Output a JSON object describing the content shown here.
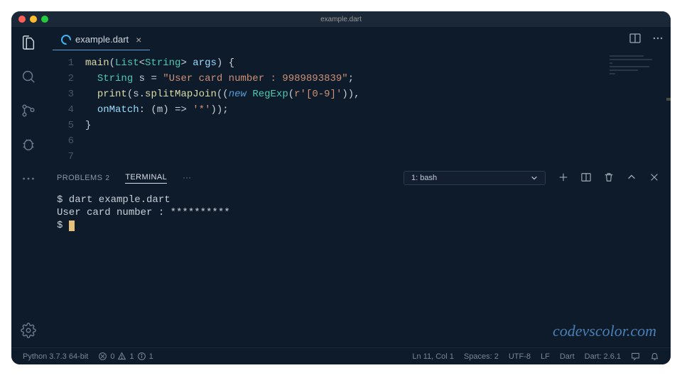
{
  "title": "example.dart",
  "tab": {
    "label": "example.dart"
  },
  "code": {
    "lines": [
      "1",
      "2",
      "3",
      "4",
      "5",
      "6",
      "7"
    ],
    "l1": {
      "fn": "main",
      "p1": "(",
      "type1": "List",
      "lt": "<",
      "type2": "String",
      "gt": ">",
      "sp": " ",
      "param": "args",
      "p2": ") {"
    },
    "l2": {
      "indent": "  ",
      "type": "String",
      "var": " s ",
      "eq": "=",
      "sp": " ",
      "str": "\"User card number : 9989893839\"",
      "sc": ";"
    },
    "l3": "",
    "l4": {
      "indent": "  ",
      "fn": "print",
      "p1": "(s.",
      "fn2": "splitMapJoin",
      "p2": "((",
      "kw": "new",
      "sp": " ",
      "cls": "RegExp",
      "p3": "(",
      "str": "r'[0-9]'",
      "p4": ")),"
    },
    "l5": {
      "indent": "  ",
      "param": "onMatch",
      "colon": ": (m) ",
      "arrow": "=>",
      "sp": " ",
      "str": "'*'",
      "p": "));"
    },
    "l6": "}"
  },
  "panel": {
    "problems": "PROBLEMS",
    "problems_count": "2",
    "terminal": "TERMINAL",
    "more": "···",
    "shell": "1: bash"
  },
  "terminal": {
    "l1": "$ dart example.dart",
    "l2": "User card number : **********",
    "l3": "$ "
  },
  "watermark": "codevscolor.com",
  "status": {
    "python": "Python 3.7.3 64-bit",
    "errors": "0",
    "warnings": "1",
    "info": "1",
    "cursor": "Ln 11, Col 1",
    "spaces": "Spaces: 2",
    "encoding": "UTF-8",
    "eol": "LF",
    "lang": "Dart",
    "dart": "Dart: 2.6.1"
  }
}
